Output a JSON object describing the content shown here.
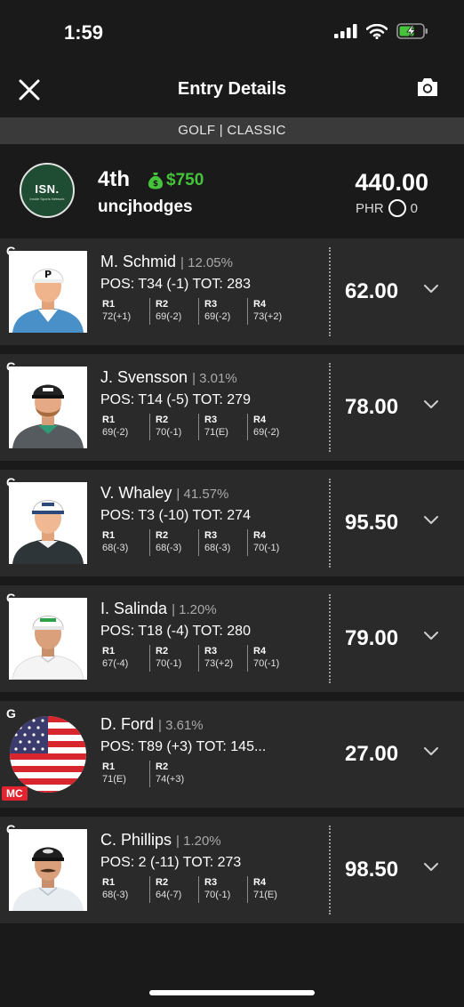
{
  "status_bar": {
    "time": "1:59"
  },
  "nav": {
    "title": "Entry Details"
  },
  "game_bar": {
    "label": "GOLF | CLASSIC"
  },
  "entry": {
    "avatar_logo": "ISN.",
    "avatar_sub": "Inside Sports Network",
    "rank": "4th",
    "prize": "$750",
    "username": "uncjhodges",
    "total_score": "440.00",
    "phr_label": "PHR",
    "phr_value": "0"
  },
  "colors": {
    "prize_green": "#45c33a",
    "mc_red": "#e1242f",
    "card_bg": "#2a2a2a"
  },
  "players": [
    {
      "pos_label": "G",
      "name": "M. Schmid",
      "ownership": "| 12.05%",
      "pos_tot": "POS: T34 (-1) TOT: 283",
      "rounds": [
        {
          "label": "R1",
          "score": "72(+1)"
        },
        {
          "label": "R2",
          "score": "69(-2)"
        },
        {
          "label": "R3",
          "score": "69(-2)"
        },
        {
          "label": "R4",
          "score": "73(+2)"
        }
      ],
      "fantasy_points": "62.00"
    },
    {
      "pos_label": "G",
      "name": "J. Svensson",
      "ownership": "| 3.01%",
      "pos_tot": "POS: T14 (-5) TOT: 279",
      "rounds": [
        {
          "label": "R1",
          "score": "69(-2)"
        },
        {
          "label": "R2",
          "score": "70(-1)"
        },
        {
          "label": "R3",
          "score": "71(E)"
        },
        {
          "label": "R4",
          "score": "69(-2)"
        }
      ],
      "fantasy_points": "78.00"
    },
    {
      "pos_label": "G",
      "name": "V. Whaley",
      "ownership": "| 41.57%",
      "pos_tot": "POS: T3 (-10) TOT: 274",
      "rounds": [
        {
          "label": "R1",
          "score": "68(-3)"
        },
        {
          "label": "R2",
          "score": "68(-3)"
        },
        {
          "label": "R3",
          "score": "68(-3)"
        },
        {
          "label": "R4",
          "score": "70(-1)"
        }
      ],
      "fantasy_points": "95.50"
    },
    {
      "pos_label": "G",
      "name": "I. Salinda",
      "ownership": "| 1.20%",
      "pos_tot": "POS: T18 (-4) TOT: 280",
      "rounds": [
        {
          "label": "R1",
          "score": "67(-4)"
        },
        {
          "label": "R2",
          "score": "70(-1)"
        },
        {
          "label": "R3",
          "score": "73(+2)"
        },
        {
          "label": "R4",
          "score": "70(-1)"
        }
      ],
      "fantasy_points": "79.00"
    },
    {
      "pos_label": "G",
      "name": "D. Ford",
      "ownership": "| 3.61%",
      "pos_tot": "POS: T89 (+3) TOT: 145...",
      "rounds": [
        {
          "label": "R1",
          "score": "71(E)"
        },
        {
          "label": "R2",
          "score": "74(+3)"
        }
      ],
      "fantasy_points": "27.00",
      "badge": "MC"
    },
    {
      "pos_label": "G",
      "name": "C. Phillips",
      "ownership": "| 1.20%",
      "pos_tot": "POS: 2 (-11) TOT: 273",
      "rounds": [
        {
          "label": "R1",
          "score": "68(-3)"
        },
        {
          "label": "R2",
          "score": "64(-7)"
        },
        {
          "label": "R3",
          "score": "70(-1)"
        },
        {
          "label": "R4",
          "score": "71(E)"
        }
      ],
      "fantasy_points": "98.50"
    }
  ]
}
